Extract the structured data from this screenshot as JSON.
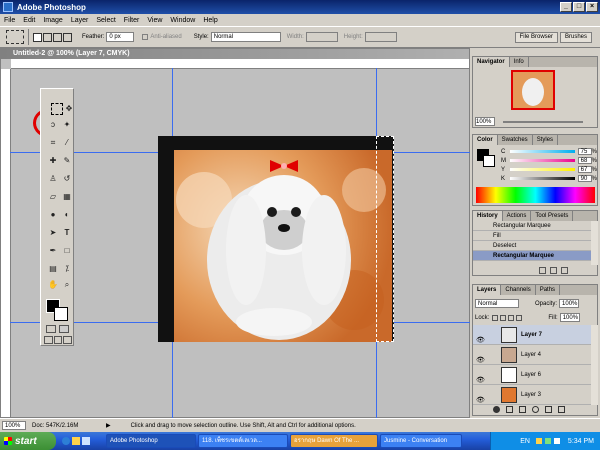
{
  "app": {
    "title": "Adobe Photoshop"
  },
  "menu": [
    "File",
    "Edit",
    "Image",
    "Layer",
    "Select",
    "Filter",
    "View",
    "Window",
    "Help"
  ],
  "options": {
    "feather_label": "Feather:",
    "feather_value": "0 px",
    "anti_aliased_label": "Anti-aliased",
    "style_label": "Style:",
    "style_value": "Normal",
    "width_label": "Width:",
    "height_label": "Height:",
    "file_browser_tab": "File Browser",
    "brushes_tab": "Brushes"
  },
  "document": {
    "title": "Untitled-2 @ 100% (Layer 7, CMYK)",
    "zoom": "100%",
    "doc_size": "Doc: 547K/2.16M",
    "status_hint": "Click and drag to move selection outline. Use Shift, Alt and Ctrl for additional options."
  },
  "navigator": {
    "tabs": [
      "Navigator",
      "Info"
    ],
    "zoom": "100%"
  },
  "color": {
    "tabs": [
      "Color",
      "Swatches",
      "Styles"
    ],
    "sliders": [
      {
        "label": "C",
        "value": "75",
        "percent": "%"
      },
      {
        "label": "M",
        "value": "68",
        "percent": "%"
      },
      {
        "label": "Y",
        "value": "67",
        "percent": "%"
      },
      {
        "label": "K",
        "value": "90",
        "percent": "%"
      }
    ]
  },
  "history": {
    "tabs": [
      "History",
      "Actions",
      "Tool Presets"
    ],
    "items": [
      "Rectangular Marquee",
      "Fill",
      "Deselect",
      "Rectangular Marquee"
    ],
    "selected_index": 3
  },
  "layers": {
    "tabs": [
      "Layers",
      "Channels",
      "Paths"
    ],
    "blend_mode": "Normal",
    "opacity_label": "Opacity:",
    "opacity_value": "100%",
    "lock_label": "Lock:",
    "fill_label": "Fill:",
    "fill_value": "100%",
    "items": [
      {
        "name": "Layer 7",
        "selected": true,
        "thumb": "#e8e8e8"
      },
      {
        "name": "Layer 4",
        "selected": false,
        "thumb": "#c8a890"
      },
      {
        "name": "Layer 6",
        "selected": false,
        "thumb": "#ffffff"
      },
      {
        "name": "Layer 3",
        "selected": false,
        "thumb": "#e07830"
      }
    ]
  },
  "taskbar": {
    "start": "start",
    "buttons": [
      {
        "label": "Adobe Photoshop",
        "active": true
      },
      {
        "label": "118. เพ็ชรเขตต์เลเวล...",
        "active": false
      },
      {
        "label": "อรากฤษ Dawn Of The ...",
        "active": false
      },
      {
        "label": "Jusmine - Conversation",
        "active": false
      }
    ],
    "lang": "EN",
    "clock": "5:34 PM"
  },
  "colors": {
    "accent_red": "#e00000",
    "photo_orange": "#e07830"
  }
}
